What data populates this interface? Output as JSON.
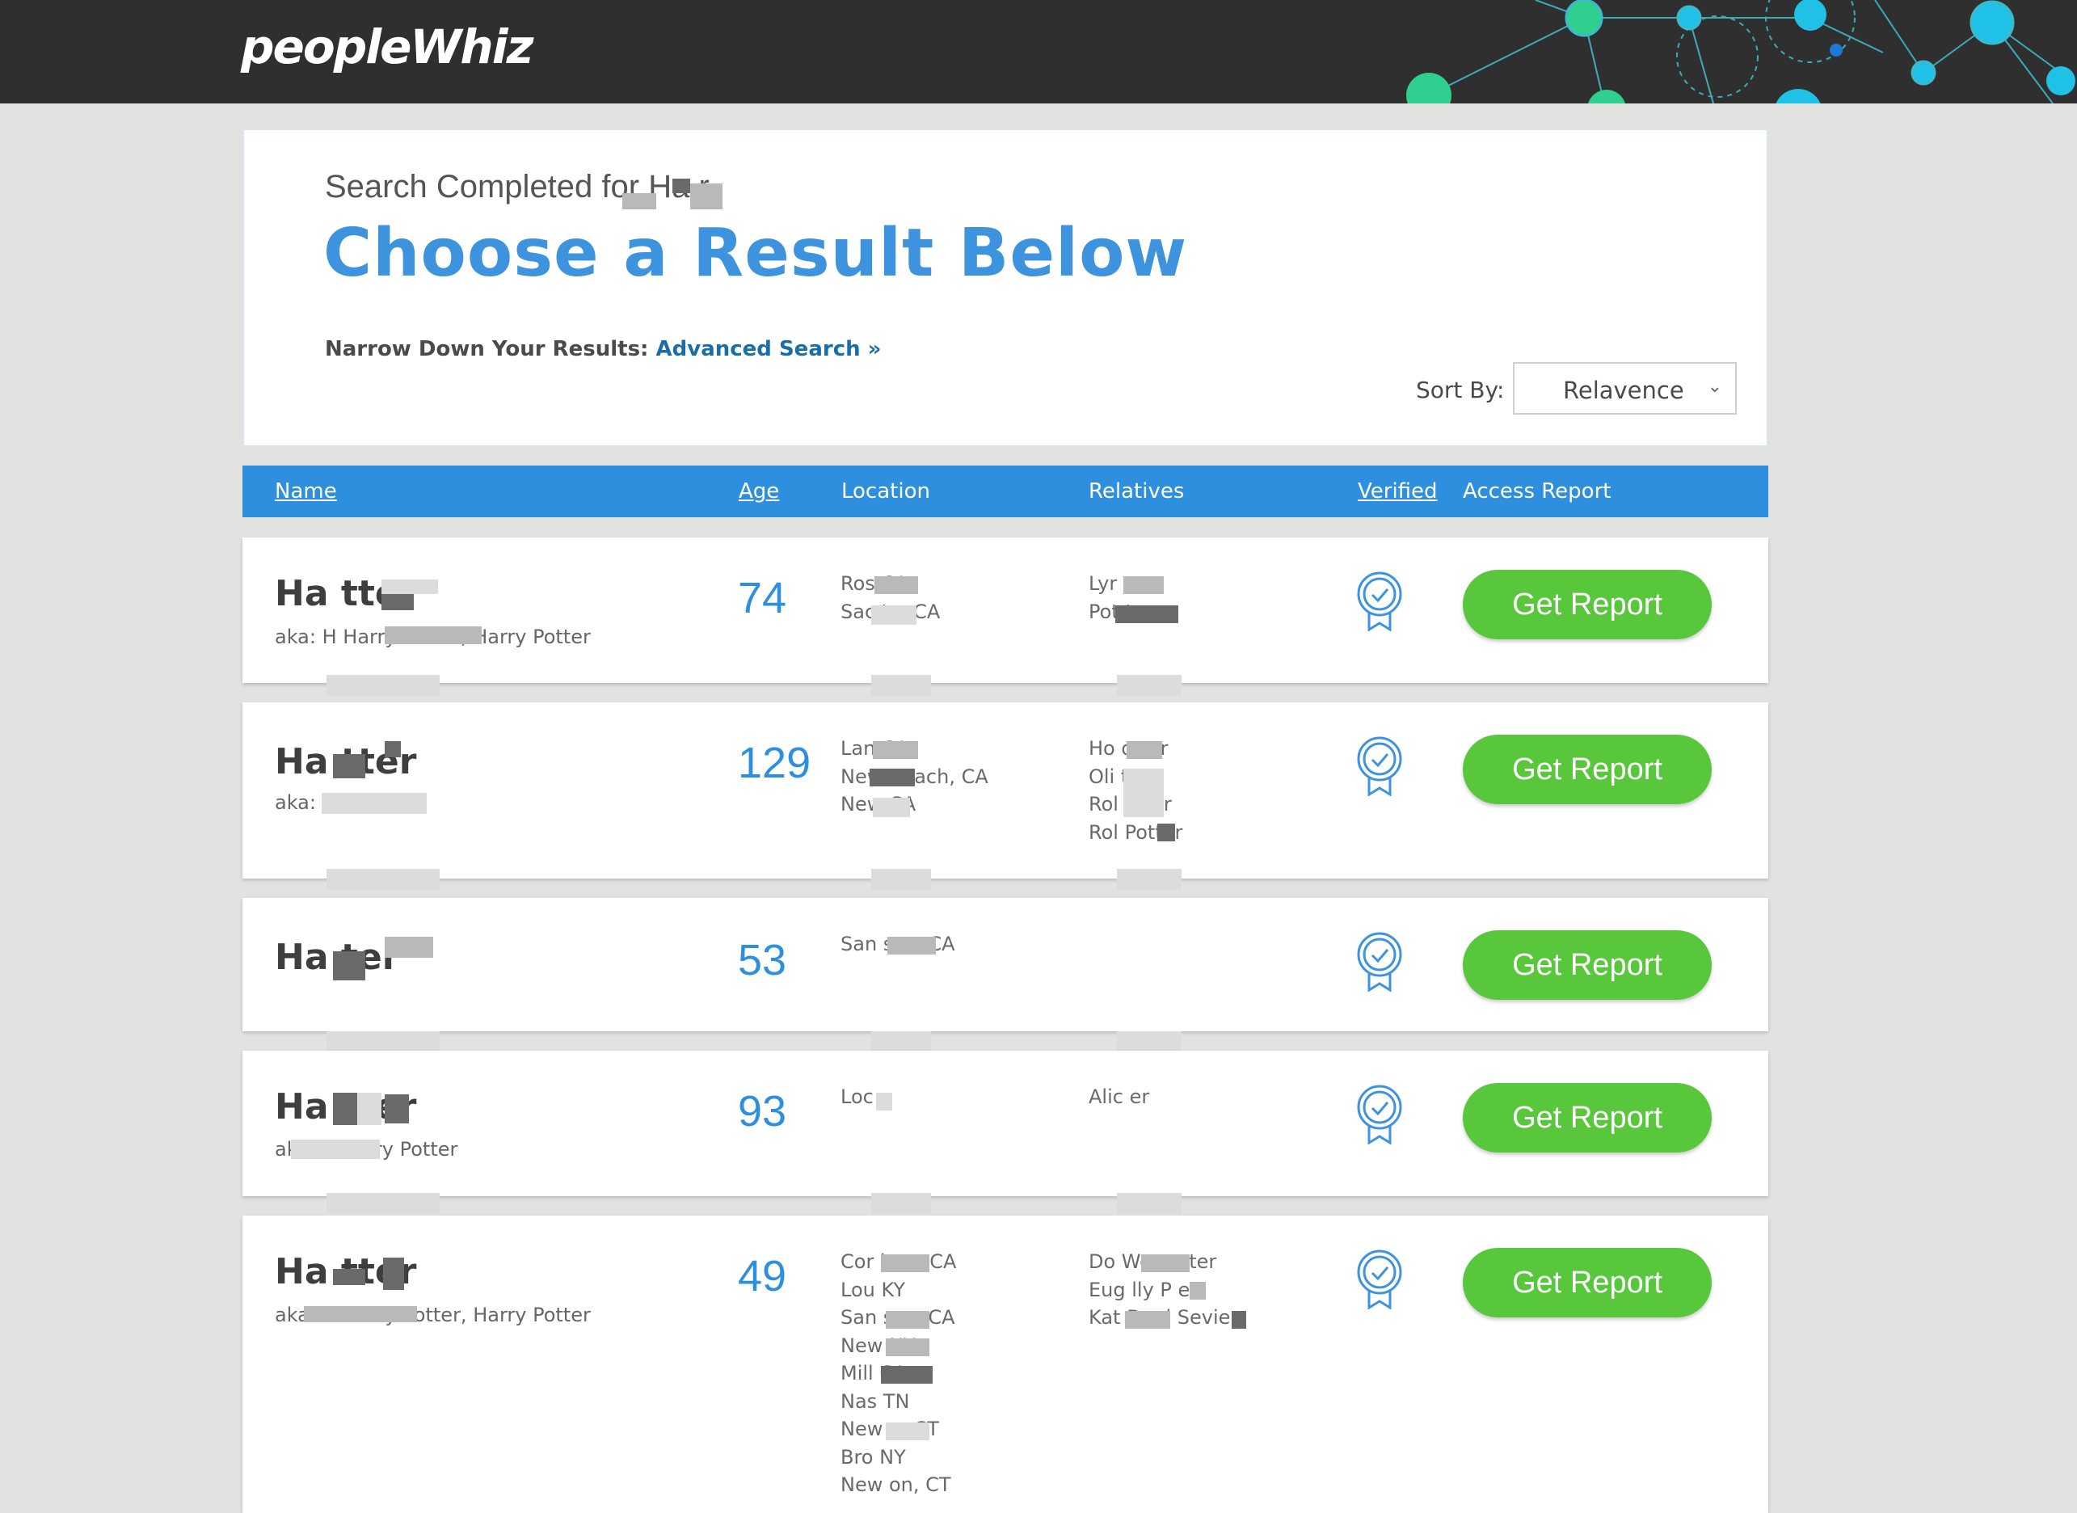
{
  "app": {
    "logo": "peopleWhiz"
  },
  "header": {
    "subtitle": "Search Completed for Ha        r",
    "title": "Choose a Result Below",
    "narrow_label": "Narrow Down Your Results:",
    "advanced_link": "Advanced Search »",
    "sort_label": "Sort By:",
    "sort_value": "Relavence"
  },
  "columns": {
    "name": "Name",
    "age": "Age",
    "location": "Location",
    "relatives": "Relatives",
    "verified": "Verified",
    "access": "Access Report"
  },
  "results": [
    {
      "name": "Ha         tter",
      "aka": "aka: H               Harry Potter, Harry Potter",
      "age": "74",
      "locations": [
        "Ros        CA",
        "Sac          to, CA"
      ],
      "relatives": [
        "Lyr           tter",
        "Pot             ter"
      ],
      "button": "Get Report"
    },
    {
      "name": "Ha         tter",
      "aka": "aka: H",
      "age": "129",
      "locations": [
        "Lan          CA",
        "New          Beach, CA",
        "New           CA"
      ],
      "relatives": [
        "Ho             otter",
        "Oli             tter",
        "Rol             otter",
        "Rol             Potter"
      ],
      "button": "Get Report"
    },
    {
      "name": "Ha         ter",
      "aka": "",
      "age": "53",
      "locations": [
        "San           sco, CA"
      ],
      "relatives": [],
      "button": "Get Report"
    },
    {
      "name": "Ha         tter",
      "aka": "aka: P                  Harry Potter",
      "age": "93",
      "locations": [
        "Loc"
      ],
      "relatives": [
        "Alic          er"
      ],
      "button": "Get Report"
    },
    {
      "name": "Ha         tter",
      "aka": "aka: H               Harry Potter, Harry Potter",
      "age": "49",
      "locations": [
        "Cor           lera, CA",
        "Lou           KY",
        "San           sco, CA",
        "New           NY",
        "Mill           CA",
        "Nas           TN",
        "New           n, CT",
        "Bro           NY",
        "New           on, CT"
      ],
      "relatives": [
        "Do           Woo       otter",
        "Eug           lly P      er",
        "Kat           Dani       Sevier"
      ],
      "button": "Get Report"
    }
  ],
  "colors": {
    "accent_blue": "#2f8fdf",
    "title_blue": "#3d93dd",
    "button_green": "#58c73c",
    "topbar": "#2f2f2f"
  }
}
